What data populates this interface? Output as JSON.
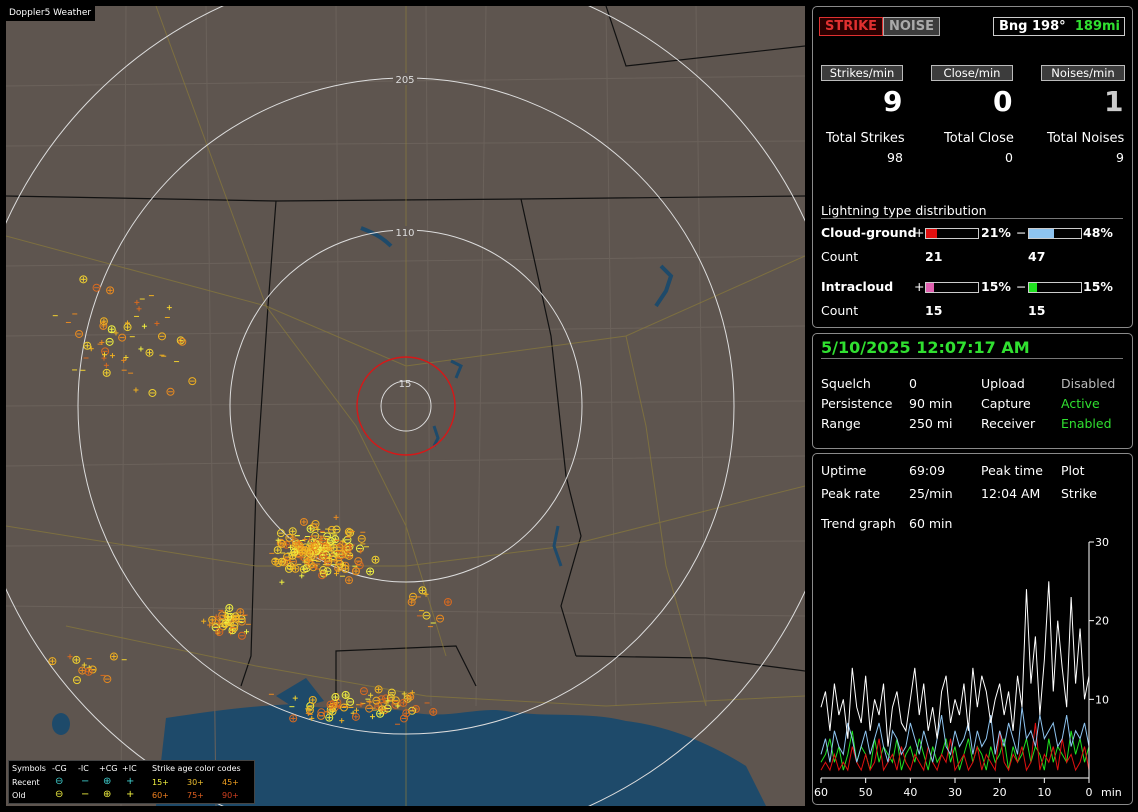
{
  "map": {
    "title": "Doppler5 Weather",
    "ring_labels": [
      "205",
      "110",
      "15"
    ]
  },
  "legend": {
    "symbols_label": "Symbols",
    "recent_label": "Recent",
    "old_label": "Old",
    "types": [
      "-CG",
      "-IC",
      "+CG",
      "+IC"
    ],
    "age_label": "Strike age color codes",
    "recent_ages": [
      "15+",
      "30+",
      "45+"
    ],
    "old_ages": [
      "60+",
      "75+",
      "90+"
    ]
  },
  "header": {
    "strike_btn": "STRIKE",
    "noise_btn": "NOISE",
    "bearing": "Bng 198°",
    "distance": "189mi"
  },
  "stats": {
    "strikes_min_label": "Strikes/min",
    "close_min_label": "Close/min",
    "noises_min_label": "Noises/min",
    "strikes_min": "9",
    "close_min": "0",
    "noises_min": "1",
    "total_strikes_label": "Total Strikes",
    "total_close_label": "Total Close",
    "total_noises_label": "Total Noises",
    "total_strikes": "98",
    "total_close": "0",
    "total_noises": "9"
  },
  "distribution": {
    "title": "Lightning type distribution",
    "cg_label": "Cloud-ground",
    "ic_label": "Intracloud",
    "count_label": "Count",
    "plus": "+",
    "minus": "−",
    "cg_pos_pct": "21%",
    "cg_neg_pct": "48%",
    "cg_pos_count": "21",
    "cg_neg_count": "47",
    "ic_pos_pct": "15%",
    "ic_neg_pct": "15%",
    "ic_pos_count": "15",
    "ic_neg_count": "15",
    "fills": {
      "cg_pos": 0.21,
      "cg_neg": 0.48,
      "ic_pos": 0.15,
      "ic_neg": 0.15
    },
    "colors": {
      "cg_pos": "#e01010",
      "cg_neg": "#8ec4f0",
      "ic_pos": "#e060b0",
      "ic_neg": "#20e020"
    }
  },
  "status": {
    "datetime": "5/10/2025 12:07:17 AM",
    "squelch_label": "Squelch",
    "squelch": "0",
    "persistence_label": "Persistence",
    "persistence": "90 min",
    "range_label": "Range",
    "range": "250 mi",
    "upload_label": "Upload",
    "upload": "Disabled",
    "capture_label": "Capture",
    "capture": "Active",
    "receiver_label": "Receiver",
    "receiver": "Enabled"
  },
  "trend": {
    "uptime_label": "Uptime",
    "uptime": "69:09",
    "peak_time_label": "Peak time",
    "plot_label": "Plot",
    "peak_rate_label": "Peak rate",
    "peak_rate": "25/min",
    "peak_time": "12:04 AM",
    "plot": "Strike",
    "trend_graph_label": "Trend graph",
    "trend_graph": "60 min",
    "y_ticks": [
      "30",
      "20",
      "10"
    ],
    "x_ticks": [
      "60",
      "50",
      "40",
      "30",
      "20",
      "10",
      "0"
    ],
    "x_unit": "min"
  },
  "chart_data": {
    "type": "line",
    "xlabel": "min",
    "xlim": [
      60,
      0
    ],
    "ylim": [
      0,
      30
    ],
    "x": [
      60,
      59,
      58,
      57,
      56,
      55,
      54,
      53,
      52,
      51,
      50,
      49,
      48,
      47,
      46,
      45,
      44,
      43,
      42,
      41,
      40,
      39,
      38,
      37,
      36,
      35,
      34,
      33,
      32,
      31,
      30,
      29,
      28,
      27,
      26,
      25,
      24,
      23,
      22,
      21,
      20,
      19,
      18,
      17,
      16,
      15,
      14,
      13,
      12,
      11,
      10,
      9,
      8,
      7,
      6,
      5,
      4,
      3,
      2,
      1,
      0
    ],
    "series": [
      {
        "color": "#ffffff",
        "values": [
          9,
          11,
          6,
          12,
          8,
          10,
          5,
          14,
          9,
          7,
          13,
          6,
          10,
          8,
          12,
          4,
          9,
          11,
          7,
          6,
          10,
          14,
          8,
          12,
          6,
          9,
          5,
          11,
          13,
          7,
          10,
          8,
          12,
          6,
          14,
          9,
          13,
          11,
          7,
          10,
          12,
          8,
          11,
          6,
          13,
          9,
          24,
          12,
          18,
          8,
          15,
          25,
          11,
          20,
          14,
          9,
          23,
          12,
          19,
          10,
          13
        ]
      },
      {
        "color": "#8ec4f0",
        "values": [
          3,
          5,
          2,
          6,
          4,
          3,
          7,
          5,
          2,
          4,
          6,
          3,
          5,
          7,
          4,
          2,
          6,
          5,
          3,
          4,
          7,
          5,
          3,
          6,
          4,
          2,
          5,
          8,
          4,
          3,
          6,
          4,
          5,
          7,
          3,
          6,
          4,
          5,
          8,
          3,
          6,
          4,
          7,
          5,
          3,
          9,
          5,
          6,
          4,
          8,
          5,
          6,
          7,
          4,
          5,
          8,
          4,
          6,
          5,
          7,
          4
        ]
      },
      {
        "color": "#e01010",
        "values": [
          1,
          2,
          1,
          3,
          1,
          2,
          1,
          4,
          2,
          1,
          3,
          1,
          2,
          5,
          1,
          2,
          3,
          1,
          4,
          2,
          1,
          3,
          2,
          1,
          4,
          2,
          1,
          3,
          2,
          5,
          1,
          2,
          3,
          1,
          2,
          4,
          1,
          3,
          2,
          1,
          6,
          2,
          1,
          3,
          2,
          4,
          1,
          2,
          7,
          1,
          3,
          2,
          4,
          1,
          5,
          2,
          3,
          1,
          2,
          4,
          1
        ]
      },
      {
        "color": "#20e020",
        "values": [
          2,
          3,
          5,
          2,
          4,
          1,
          3,
          6,
          2,
          4,
          3,
          1,
          5,
          2,
          4,
          3,
          2,
          5,
          1,
          3,
          4,
          2,
          5,
          3,
          1,
          4,
          2,
          3,
          5,
          2,
          4,
          1,
          3,
          5,
          2,
          4,
          3,
          1,
          4,
          2,
          3,
          5,
          1,
          4,
          2,
          3,
          5,
          2,
          4,
          3,
          1,
          5,
          2,
          4,
          3,
          2,
          6,
          3,
          5,
          2,
          4
        ]
      }
    ]
  }
}
